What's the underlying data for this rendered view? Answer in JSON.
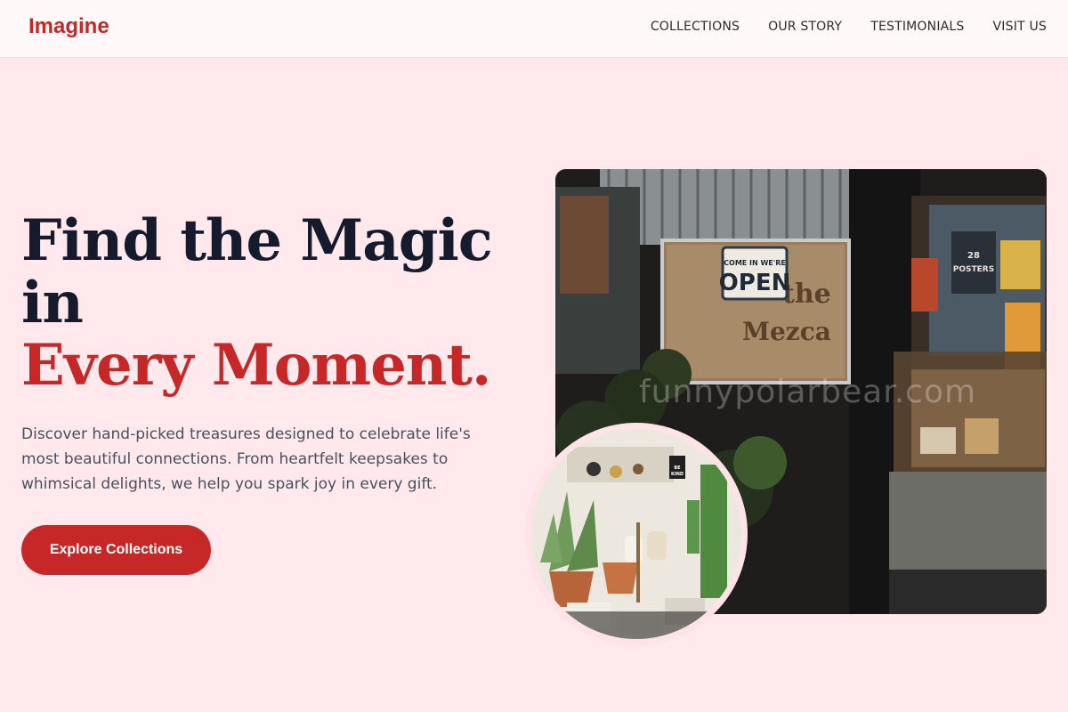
{
  "header": {
    "logo": "Imagine",
    "nav": [
      "COLLECTIONS",
      "OUR STORY",
      "TESTIMONIALS",
      "VISIT US"
    ]
  },
  "hero": {
    "headline_line1": "Find the Magic",
    "headline_line2": "in",
    "headline_accent": "Every Moment.",
    "description": "Discover hand-picked treasures designed to celebrate life's most beautiful connections. From heartfelt keepsakes to whimsical delights, we help you spark joy in every gift.",
    "cta_label": "Explore Collections"
  },
  "images": {
    "main_sign_text": "COME IN WE'RE OPEN",
    "poster_text": "28 POSTERS",
    "watermark": "funnypolarbear.com",
    "small_sign_text": "BE KIND"
  },
  "colors": {
    "accent": "#c62828",
    "background": "#ffe9ec",
    "headline": "#151a2c"
  }
}
